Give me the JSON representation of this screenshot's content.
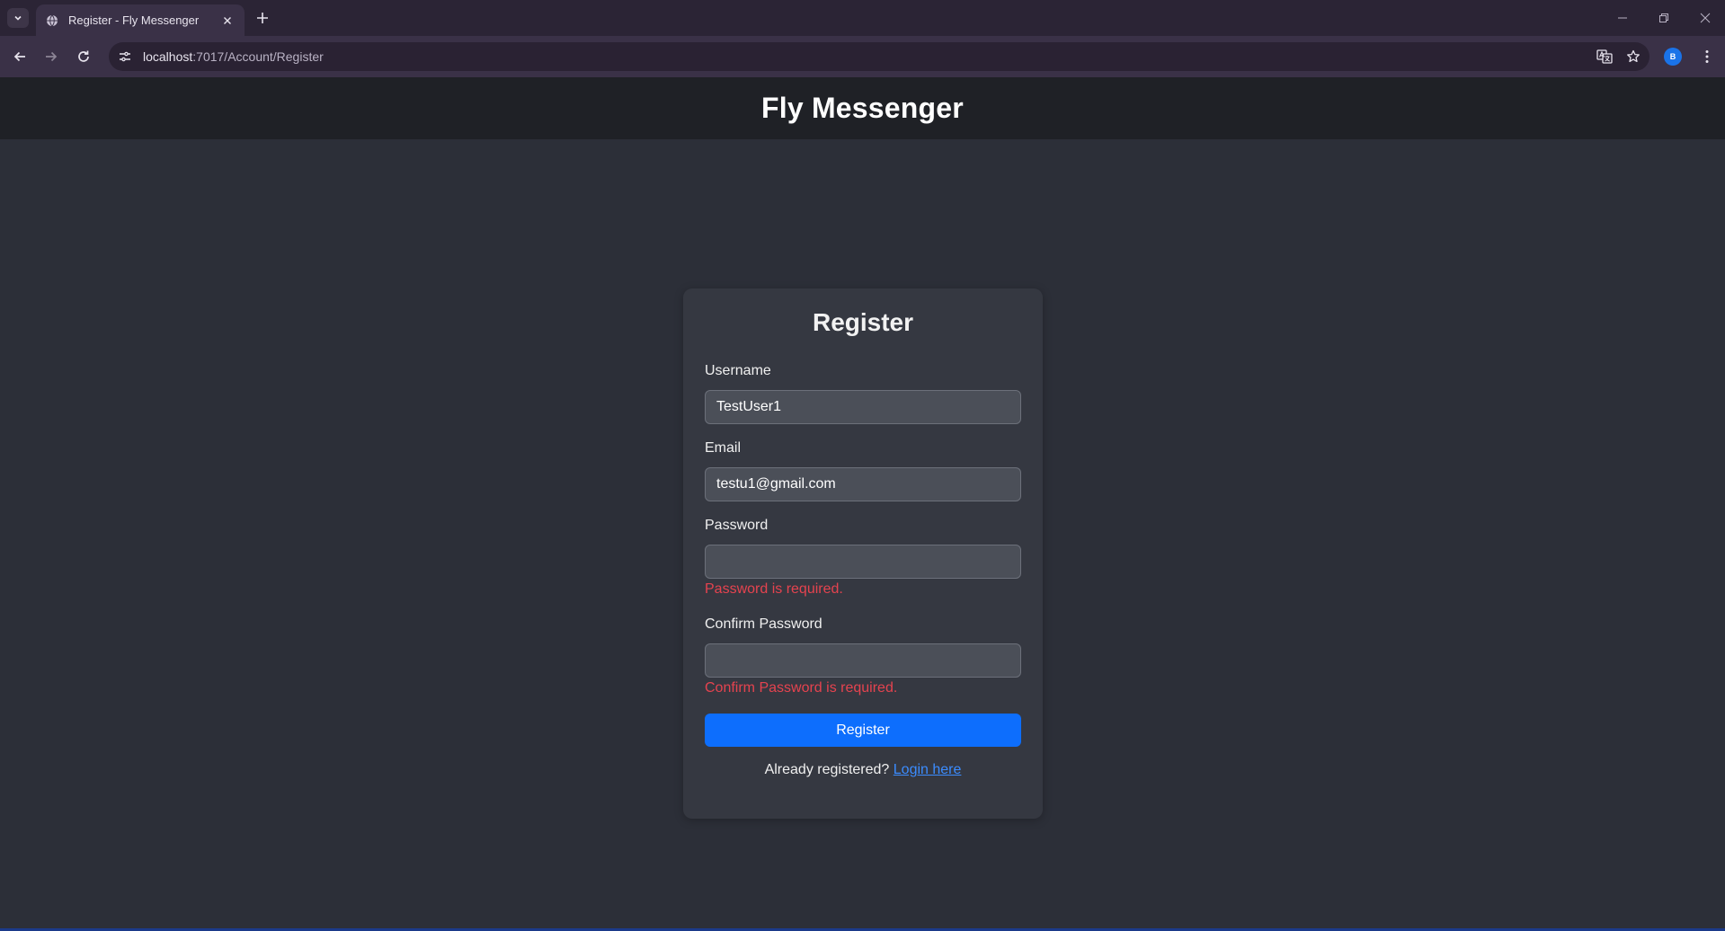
{
  "browser": {
    "tab_title": "Register - Fly Messenger",
    "url_host": "localhost",
    "url_rest": ":7017/Account/Register",
    "profile_initial": "B"
  },
  "site": {
    "title": "Fly Messenger"
  },
  "form": {
    "heading": "Register",
    "username": {
      "label": "Username",
      "value": "TestUser1"
    },
    "email": {
      "label": "Email",
      "value": "testu1@gmail.com"
    },
    "password": {
      "label": "Password",
      "value": "",
      "error": "Password is required."
    },
    "confirm_password": {
      "label": "Confirm Password",
      "value": "",
      "error": "Confirm Password is required."
    },
    "submit_label": "Register",
    "login_prompt": "Already registered?",
    "login_link": "Login here"
  },
  "colors": {
    "page_bg": "#2c2f38",
    "header_bg": "#1f2126",
    "card_bg": "#353841",
    "accent": "#0d6efd",
    "error": "#e5434f",
    "link": "#3b8cff"
  }
}
